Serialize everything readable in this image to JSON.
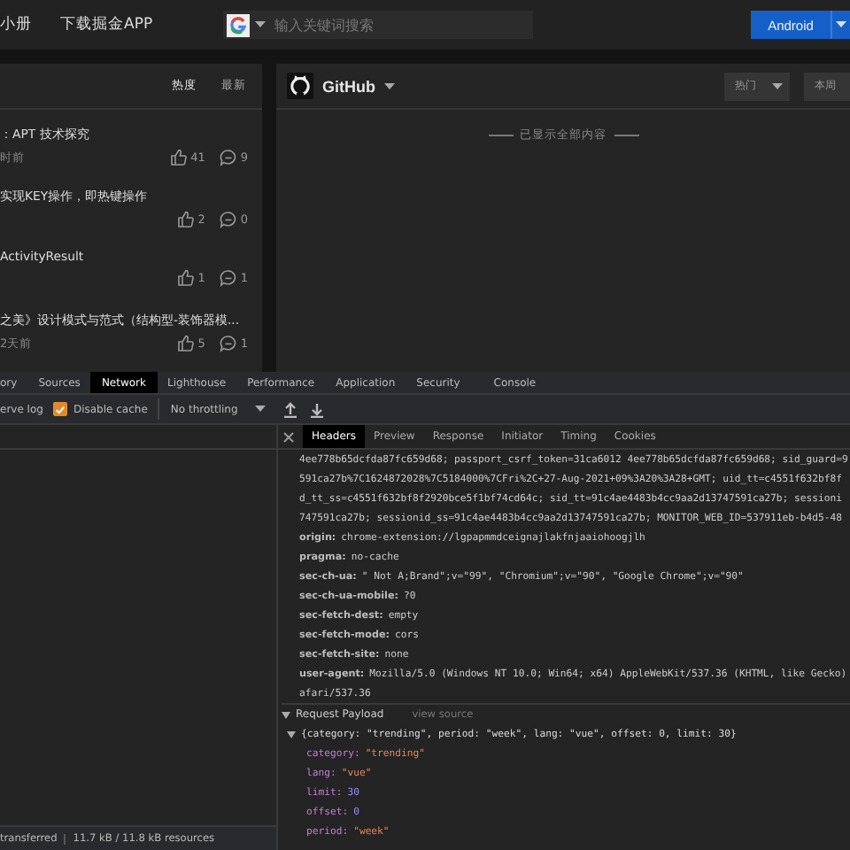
{
  "top_bar": {
    "nav": [
      "小册",
      "下载掘金APP"
    ],
    "search": {
      "placeholder": "输入关键词搜索"
    },
    "platform_button": "Android"
  },
  "article_panel": {
    "sort_tabs": [
      {
        "label": "热度",
        "selected": true
      },
      {
        "label": "最新",
        "selected": false
      }
    ],
    "articles": [
      {
        "title": "：APT 技术探究",
        "meta": "时前",
        "likes": "41",
        "comments": "9"
      },
      {
        "title": "实现KEY操作，即热键操作",
        "likes": "2",
        "comments": "0"
      },
      {
        "title": "ActivityResult",
        "likes": "1",
        "comments": "1"
      },
      {
        "title": "之美》设计模式与范式（结构型-装饰器模...",
        "meta": "2天前",
        "likes": "5",
        "comments": "1"
      }
    ]
  },
  "github_panel": {
    "title": "GitHub",
    "filters": [
      {
        "label": "热门",
        "kind": "dropdown"
      },
      {
        "label": "本周",
        "kind": "plain"
      }
    ],
    "end_note": "已显示全部内容"
  },
  "devtools": {
    "panel_tabs": [
      {
        "label": "ory",
        "selected": false
      },
      {
        "label": "Sources",
        "selected": false
      },
      {
        "label": "Network",
        "selected": true
      },
      {
        "label": "Lighthouse",
        "selected": false
      },
      {
        "label": "Performance",
        "selected": false
      },
      {
        "label": "Application",
        "selected": false
      },
      {
        "label": "Security",
        "selected": false
      },
      {
        "label": "Console",
        "selected": false
      }
    ],
    "toolbar": {
      "preserve_log": "erve log",
      "disable_cache": {
        "label": "Disable cache",
        "checked": true
      },
      "throttling": "No throttling"
    },
    "status_bar": [
      "transferred",
      "11.7 kB / 11.8 kB resources"
    ],
    "detail_tabs": [
      {
        "label": "Headers",
        "selected": true
      },
      {
        "label": "Preview",
        "selected": false
      },
      {
        "label": "Response",
        "selected": false
      },
      {
        "label": "Initiator",
        "selected": false
      },
      {
        "label": "Timing",
        "selected": false
      },
      {
        "label": "Cookies",
        "selected": false
      }
    ],
    "cookie_lines": [
      "4ee778b65dcfda87fc659d68; passport_csrf_token=31ca6012 4ee778b65dcfda87fc659d68; sid_guard=9",
      "591ca27b%7C1624872028%7C5184000%7CFri%2C+27-Aug-2021+09%3A20%3A28+GMT; uid_tt=c4551f632bf8f",
      "d_tt_ss=c4551f632bf8f2920bce5f1bf74cd64c; sid_tt=91c4ae4483b4cc9aa2d13747591ca27b; sessioni",
      "747591ca27b; sessionid_ss=91c4ae4483b4cc9aa2d13747591ca27b; MONITOR_WEB_ID=537911eb-b4d5-48"
    ],
    "headers": [
      {
        "name": "origin:",
        "value": "chrome-extension://lgpapmmdceignajlakfnjaaiohoogjlh"
      },
      {
        "name": "pragma:",
        "value": "no-cache"
      },
      {
        "name": "sec-ch-ua:",
        "value": "\" Not A;Brand\";v=\"99\", \"Chromium\";v=\"90\", \"Google Chrome\";v=\"90\""
      },
      {
        "name": "sec-ch-ua-mobile:",
        "value": "?0"
      },
      {
        "name": "sec-fetch-dest:",
        "value": "empty"
      },
      {
        "name": "sec-fetch-mode:",
        "value": "cors"
      },
      {
        "name": "sec-fetch-site:",
        "value": "none"
      },
      {
        "name": "user-agent:",
        "value": "Mozilla/5.0 (Windows NT 10.0; Win64; x64) AppleWebKit/537.36 (KHTML, like Gecko)"
      }
    ],
    "ua_continuation": "afari/537.36",
    "payload": {
      "title": "Request Payload",
      "view_source": "view source",
      "summary": "{category: \"trending\", period: \"week\", lang: \"vue\", offset: 0, limit: 30}",
      "properties": [
        {
          "key": "category:",
          "value": "\"trending\"",
          "kind": "string"
        },
        {
          "key": "lang:",
          "value": "\"vue\"",
          "kind": "string"
        },
        {
          "key": "limit:",
          "value": "30",
          "kind": "number"
        },
        {
          "key": "offset:",
          "value": "0",
          "kind": "number"
        },
        {
          "key": "period:",
          "value": "\"week\"",
          "kind": "string"
        }
      ]
    }
  }
}
